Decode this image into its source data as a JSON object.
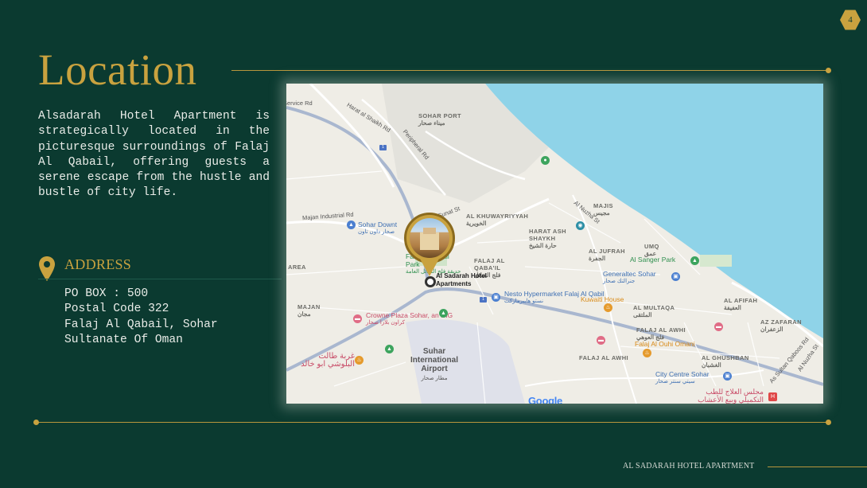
{
  "page_number": "4",
  "title": "Location",
  "intro": "Alsadarah Hotel Apartment is strategically located in the picturesque surroundings of Falaj Al Qabail, offering guests a serene escape from the hustle and bustle of city life.",
  "address": {
    "heading": "ADDRESS",
    "lines": [
      "PO BOX : 500",
      "Postal Code 322",
      "Falaj Al Qabail, Sohar",
      "Sultanate Of Oman"
    ]
  },
  "map": {
    "hotel_name": "Al Sadarah Hotel Apartments",
    "roads": [
      "Service Rd",
      "Harat al Shaikh Rd",
      "Peripheral Rd",
      "Majan Industrial Rd",
      "Sunat St",
      "Al Nuzha St",
      "As Sultan Qaboos Rd",
      "Al Nuzha St"
    ],
    "areas": [
      {
        "name": "SOHAR PORT",
        "ar": "ميناء صحار"
      },
      {
        "name": "AL KHUWAYRIYYAH",
        "ar": "الخويرية"
      },
      {
        "name": "MAJIS",
        "ar": "مجيس"
      },
      {
        "name": "HARAT ASH SHAYKH",
        "ar": "حارة الشيخ"
      },
      {
        "name": "AL JUFRAH",
        "ar": "الجفرة"
      },
      {
        "name": "UMQ",
        "ar": "عمق"
      },
      {
        "name": "FALAJ AL QABA'IL",
        "ar": "فلج القبائل"
      },
      {
        "name": "AREA",
        "ar": ""
      },
      {
        "name": "MAJAN",
        "ar": "مجان"
      },
      {
        "name": "AL MULTAQA",
        "ar": "الملتقى"
      },
      {
        "name": "AL AFIFAH",
        "ar": "العفيفة"
      },
      {
        "name": "AZ ZAFARAN",
        "ar": "الزعفران"
      },
      {
        "name": "FALAJ AL AWHI",
        "ar": "فلج العوهي"
      },
      {
        "name": "AL GHUSHBAN",
        "ar": "الغشبان"
      },
      {
        "name": "FALAJ AL AWHI",
        "ar": ""
      }
    ],
    "pois": {
      "sohar_downtown": "Sohar Downt",
      "sohar_downtown_ar": "صحار داون تاون",
      "park": "Falaj Al Qabail Park",
      "park_ar": "حديقة فلج القبائل العامة",
      "nesto": "Nesto Hypermarket Falaj Al Qabil",
      "nesto_ar": "نستو هايبرماركت",
      "kuwaiti_house": "Kuwaiti House",
      "al_sanger_park": "Al Sanger Park",
      "generaltec": "Generaltec Sohar",
      "generaltec_ar": "جنرالتك صحار",
      "crowne_plaza": "Crowne Plaza Sohar, an IHG",
      "crowne_plaza_ar": "كراون بلازا صحار",
      "restaurant_ar": "غربة طالت البلوشي ابو خالد",
      "airport": "Suhar International Airport",
      "airport_ar": "مطار صحار",
      "falaj_ouhi_omani": "Falaj Al Ouhi Omani",
      "city_centre": "City Centre Sohar",
      "city_centre_ar": "سيتي سنتر صحار",
      "clinic_ar": "مجلس العلاج للطب التكميلي وبيع الأعشاب",
      "google": "Google"
    }
  },
  "footer": "AL SADARAH HOTEL APARTMENT",
  "colors": {
    "background": "#0b3a30",
    "gold": "#c9a23f",
    "text": "#e9ece8",
    "sea": "#8fd3e8",
    "land": "#efede6"
  }
}
